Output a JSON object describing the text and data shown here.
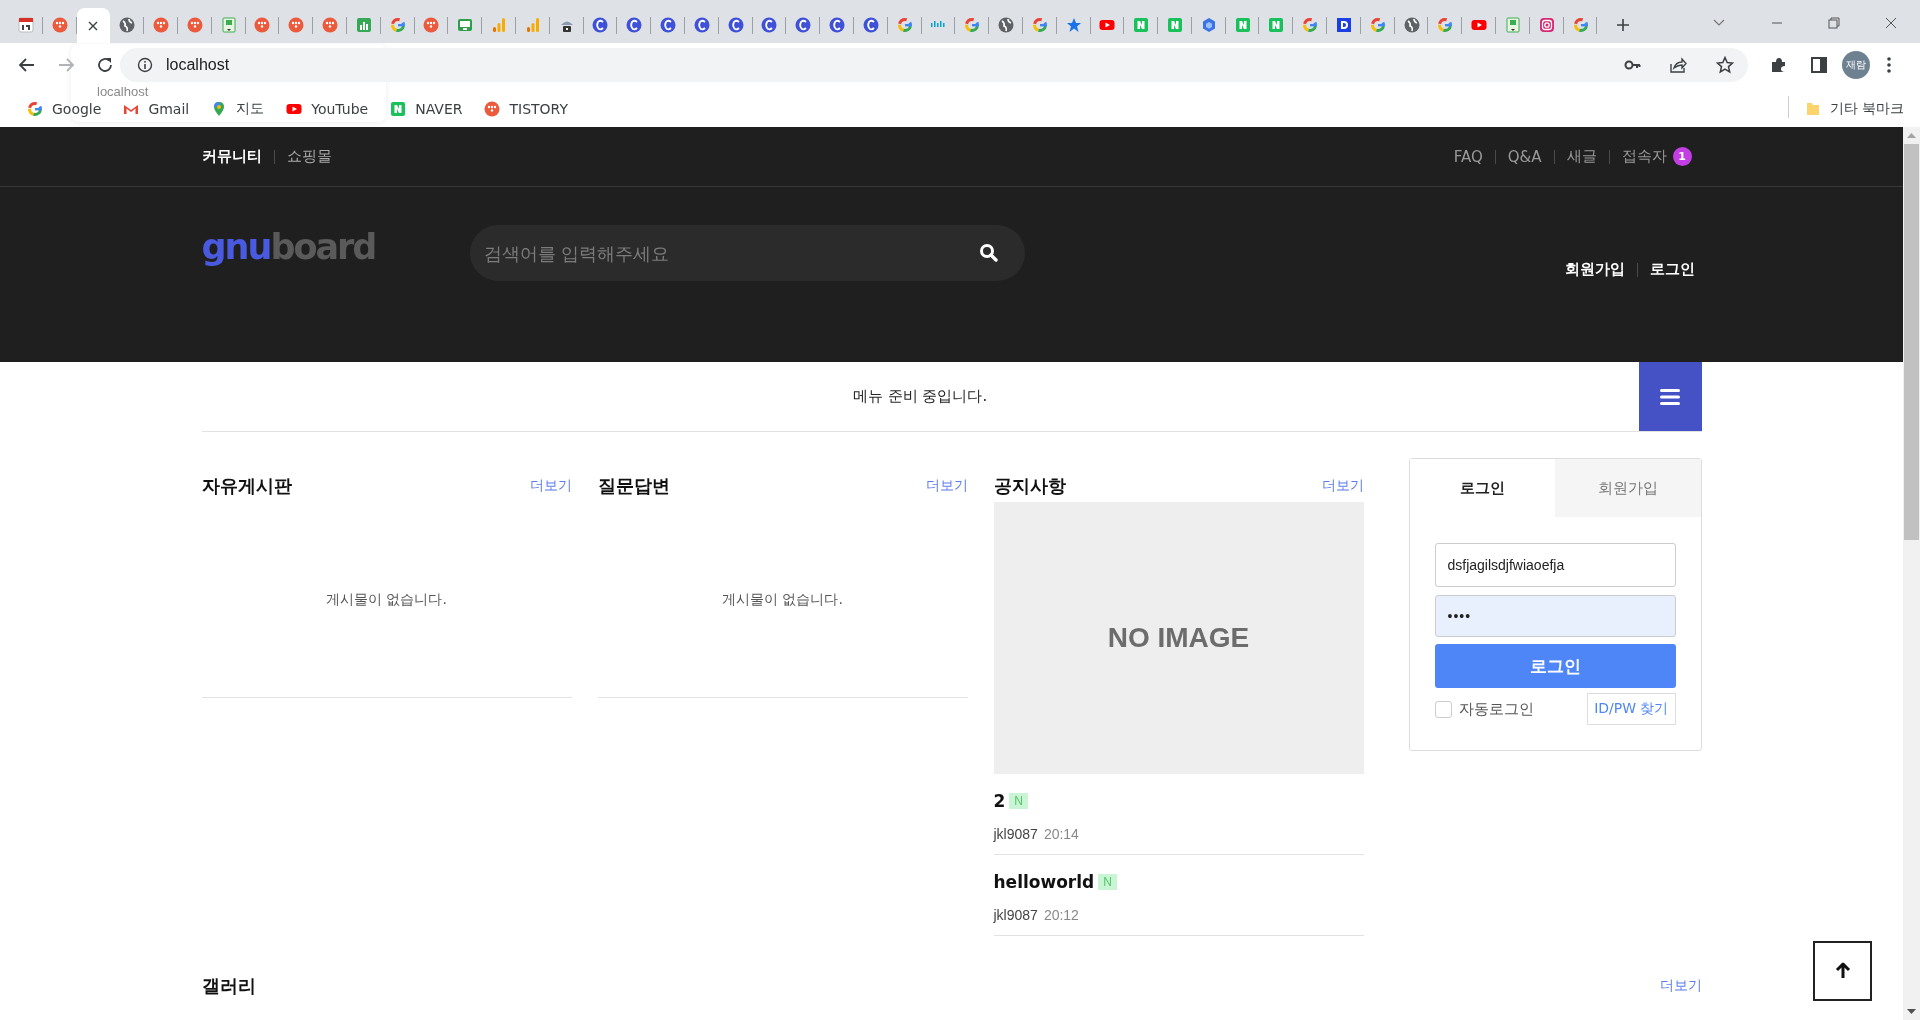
{
  "browser": {
    "tabs": [
      {
        "kind": "calendar",
        "selected": false
      },
      {
        "kind": "tistory",
        "selected": false
      },
      {
        "kind": "page",
        "selected": true
      },
      {
        "kind": "globe",
        "selected": false
      },
      {
        "kind": "tistory",
        "selected": false
      },
      {
        "kind": "tistory",
        "selected": false
      },
      {
        "kind": "memo",
        "selected": false
      },
      {
        "kind": "tistory",
        "selected": false
      },
      {
        "kind": "tistory",
        "selected": false
      },
      {
        "kind": "tistory",
        "selected": false
      },
      {
        "kind": "sheets",
        "selected": false
      },
      {
        "kind": "google",
        "selected": false
      },
      {
        "kind": "tistory",
        "selected": false
      },
      {
        "kind": "monitor",
        "selected": false
      },
      {
        "kind": "analytics",
        "selected": false
      },
      {
        "kind": "analytics",
        "selected": false
      },
      {
        "kind": "lock",
        "selected": false
      },
      {
        "kind": "c",
        "selected": false
      },
      {
        "kind": "c",
        "selected": false
      },
      {
        "kind": "c",
        "selected": false
      },
      {
        "kind": "c",
        "selected": false
      },
      {
        "kind": "c",
        "selected": false
      },
      {
        "kind": "c",
        "selected": false
      },
      {
        "kind": "c",
        "selected": false
      },
      {
        "kind": "c",
        "selected": false
      },
      {
        "kind": "c",
        "selected": false
      },
      {
        "kind": "google",
        "selected": false
      },
      {
        "kind": "cisco",
        "selected": false
      },
      {
        "kind": "google",
        "selected": false
      },
      {
        "kind": "globe",
        "selected": false
      },
      {
        "kind": "google",
        "selected": false
      },
      {
        "kind": "star",
        "selected": false
      },
      {
        "kind": "youtube",
        "selected": false
      },
      {
        "kind": "naver",
        "selected": false
      },
      {
        "kind": "naver",
        "selected": false
      },
      {
        "kind": "cube",
        "selected": false
      },
      {
        "kind": "naver",
        "selected": false
      },
      {
        "kind": "naver",
        "selected": false
      },
      {
        "kind": "google",
        "selected": false
      },
      {
        "kind": "daum",
        "selected": false
      },
      {
        "kind": "google",
        "selected": false
      },
      {
        "kind": "globe",
        "selected": false
      },
      {
        "kind": "google",
        "selected": false
      },
      {
        "kind": "youtube",
        "selected": false
      },
      {
        "kind": "memo",
        "selected": false
      },
      {
        "kind": "instagram",
        "selected": false
      },
      {
        "kind": "google",
        "selected": false
      }
    ],
    "hover_card": {
      "url": "localhost"
    },
    "address": "localhost",
    "profile": "재람",
    "bookmarks": [
      {
        "kind": "google",
        "label": "Google"
      },
      {
        "kind": "gmail",
        "label": "Gmail"
      },
      {
        "kind": "maps",
        "label": "지도"
      },
      {
        "kind": "youtube",
        "label": "YouTube"
      },
      {
        "kind": "naver",
        "label": "NAVER"
      },
      {
        "kind": "tistory",
        "label": "TISTORY"
      }
    ],
    "other_bookmarks": "기타 북마크"
  },
  "site": {
    "top_links_left": [
      {
        "label": "커뮤니티",
        "selected": true
      },
      {
        "label": "쇼핑몰",
        "selected": false
      }
    ],
    "top_links_right": [
      {
        "label": "FAQ"
      },
      {
        "label": "Q&A"
      },
      {
        "label": "새글"
      },
      {
        "label": "접속자",
        "badge": "1"
      }
    ],
    "logo": [
      "gnu",
      "board"
    ],
    "search": {
      "placeholder": "검색어를 입력해주세요"
    },
    "member_links": [
      "회원가입",
      "로그인"
    ],
    "menu_notice": "메뉴 준비 중입니다.",
    "boards": [
      {
        "title": "자유게시판",
        "more": "더보기",
        "empty": "게시물이 없습니다."
      },
      {
        "title": "질문답변",
        "more": "더보기",
        "empty": "게시물이 없습니다."
      }
    ],
    "notice": {
      "title": "공지사항",
      "more": "더보기",
      "image_text": "NO IMAGE",
      "posts": [
        {
          "title": "2",
          "badge": "N",
          "author": "jkl9087",
          "time": "20:14"
        },
        {
          "title": "helloworld",
          "badge": "N",
          "author": "jkl9087",
          "time": "20:12"
        }
      ]
    },
    "login": {
      "tabs": [
        {
          "label": "로그인",
          "selected": true
        },
        {
          "label": "회원가입",
          "selected": false
        }
      ],
      "id_value": "dsfjagilsdjfwiaoefja",
      "password_value": "••••",
      "button": "로그인",
      "auto_login": {
        "label": "자동로그인",
        "checked": false
      },
      "find": "ID/PW 찾기"
    },
    "gallery": {
      "title": "갤러리",
      "more": "더보기"
    }
  }
}
